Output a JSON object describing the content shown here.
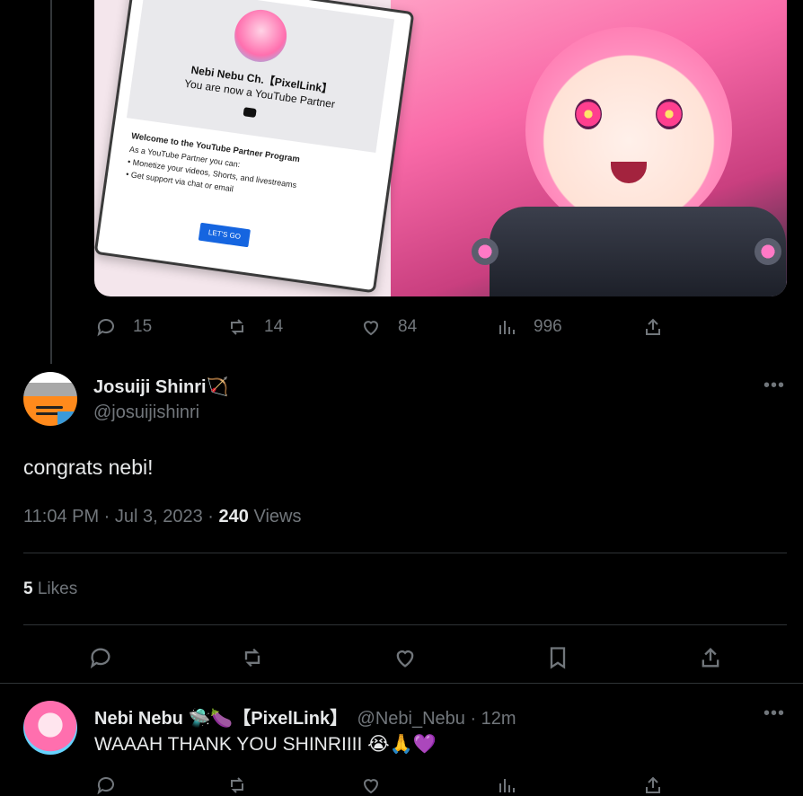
{
  "media_card": {
    "channel_name": "Nebi Nebu Ch.【PixelLink】",
    "partner_line": "You are now a YouTube Partner",
    "welcome": "Welcome to the YouTube Partner Program",
    "as_partner": "As a YouTube Partner you can:",
    "bullet1": "Monetize your videos, Shorts, and livestreams",
    "bullet2": "Get support via chat or email",
    "cta": "LET'S GO"
  },
  "prev_tweet_actions": {
    "replies": "15",
    "reposts": "14",
    "likes": "84",
    "views": "996"
  },
  "main_tweet": {
    "display_name": "Josuiji Shinri🏹",
    "handle": "@josuijishinri",
    "text": "congrats nebi!",
    "timestamp": "11:04 PM · Jul 3, 2023 · ",
    "views_count": "240",
    "views_label": " Views",
    "likes_count": "5",
    "likes_label": " Likes"
  },
  "reply_tweet": {
    "display_name": "Nebi Nebu 🛸🍆【PixelLink】",
    "handle": "@Nebi_Nebu",
    "time": " · 12m",
    "text": "WAAAH THANK YOU SHINRIIII 😭🙏💜"
  },
  "colors": {
    "background": "#000000",
    "text_primary": "#e7e9ea",
    "text_secondary": "#71767b",
    "divider": "#2f3336"
  }
}
